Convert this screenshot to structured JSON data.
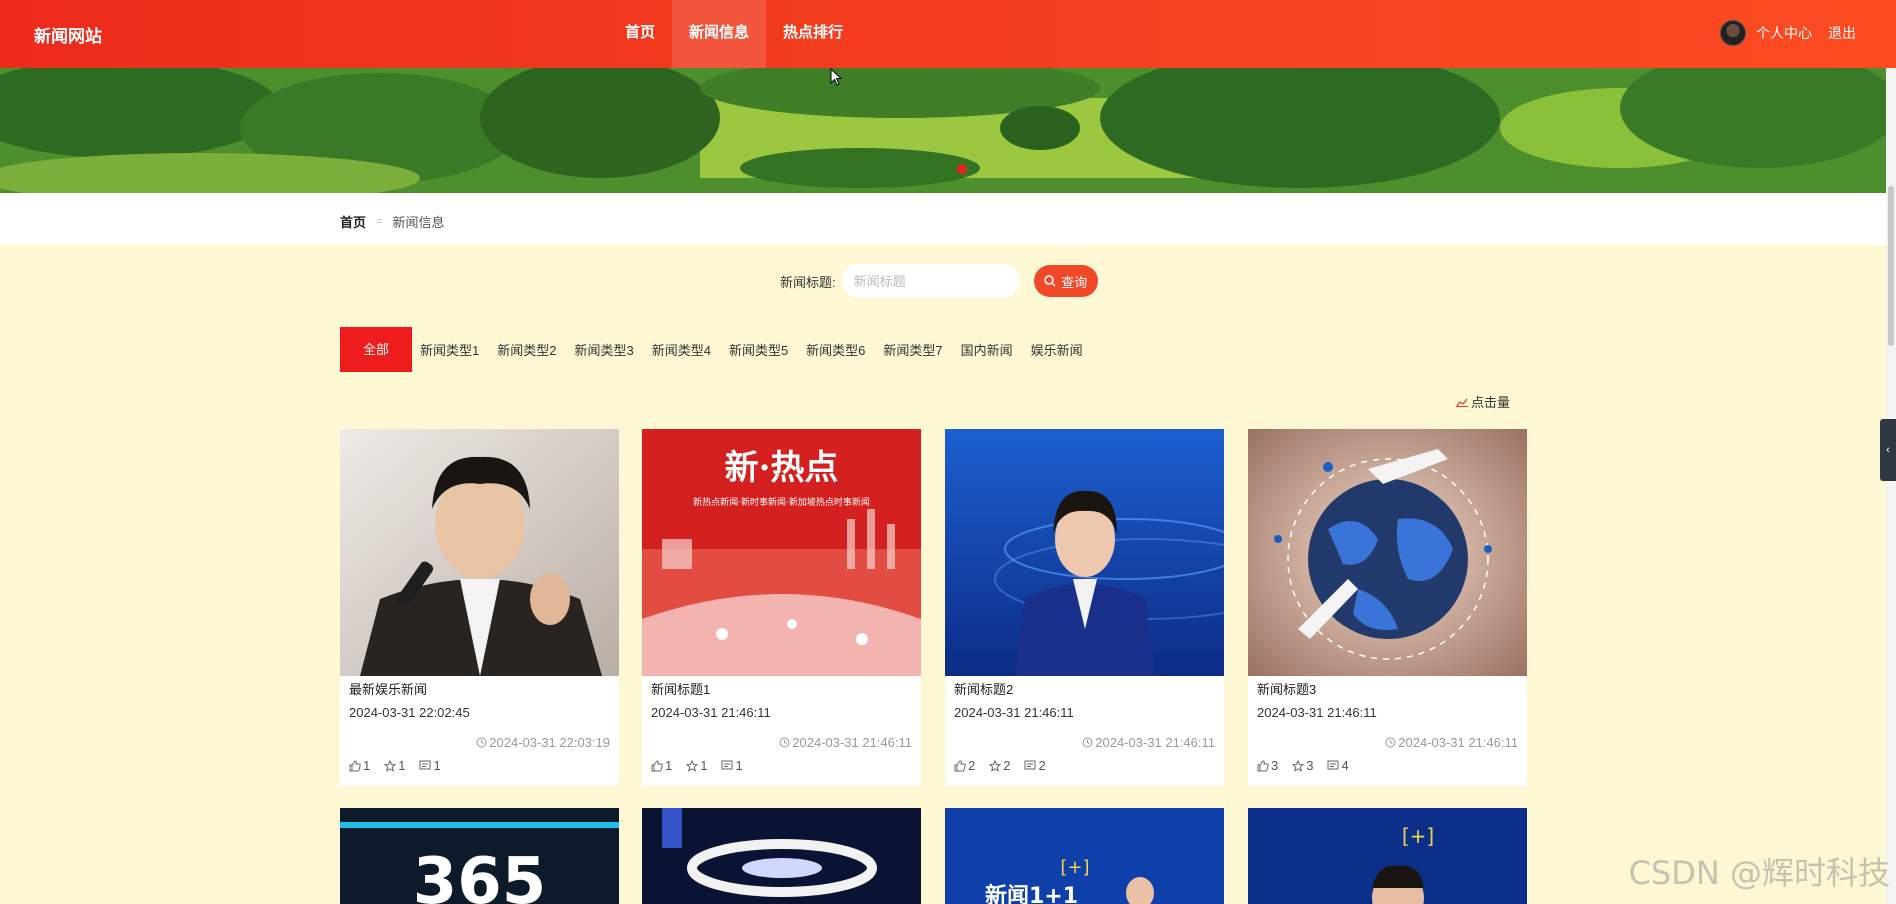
{
  "header": {
    "logo": "新闻网站",
    "nav": [
      {
        "label": "首页",
        "active": false
      },
      {
        "label": "新闻信息",
        "active": true
      },
      {
        "label": "热点排行",
        "active": false
      }
    ],
    "user_center": "个人中心",
    "logout": "退出"
  },
  "breadcrumb": {
    "home": "首页",
    "current": "新闻信息"
  },
  "search": {
    "label": "新闻标题:",
    "placeholder": "新闻标题",
    "value": "",
    "button": "查询"
  },
  "categories": [
    "全部",
    "新闻类型1",
    "新闻类型2",
    "新闻类型3",
    "新闻类型4",
    "新闻类型5",
    "新闻类型6",
    "新闻类型7",
    "国内新闻",
    "娱乐新闻"
  ],
  "sort_label": "点击量",
  "cards": [
    {
      "title": "最新娱乐新闻",
      "sub": "2024-03-31 22:02:45",
      "time": "2024-03-31 22:03:19",
      "likes": "1",
      "favorites": "1",
      "comments": "1",
      "image": "singer-photo"
    },
    {
      "title": "新闻标题1",
      "sub": "2024-03-31 21:46:11",
      "time": "2024-03-31 21:46:11",
      "likes": "1",
      "favorites": "1",
      "comments": "1",
      "image": "red-hot-news-poster",
      "image_text": "新·热点",
      "image_caption": "新热点新闻·新时事新闻·新加坡热点时事新闻"
    },
    {
      "title": "新闻标题2",
      "sub": "2024-03-31 21:46:11",
      "time": "2024-03-31 21:46:11",
      "likes": "2",
      "favorites": "2",
      "comments": "2",
      "image": "news-anchor-studio"
    },
    {
      "title": "新闻标题3",
      "sub": "2024-03-31 21:46:11",
      "time": "2024-03-31 21:46:11",
      "likes": "3",
      "favorites": "3",
      "comments": "4",
      "image": "globe-airplanes"
    }
  ],
  "row2": [
    {
      "image": "365-digital-screen",
      "text": "365"
    },
    {
      "image": "tv-studio-ring"
    },
    {
      "image": "news-1plus1",
      "text": "新闻1+1",
      "badge": "[+]"
    },
    {
      "image": "news-anchor-map",
      "badge": "[+]"
    }
  ],
  "side_tab_icon": "chevron-left-icon",
  "watermark": "CSDN @辉时科技",
  "colors": {
    "header": "#ee2a1c",
    "accent": "#f0492a",
    "active_category": "#ee1c1c",
    "background": "#fdf8d3"
  }
}
